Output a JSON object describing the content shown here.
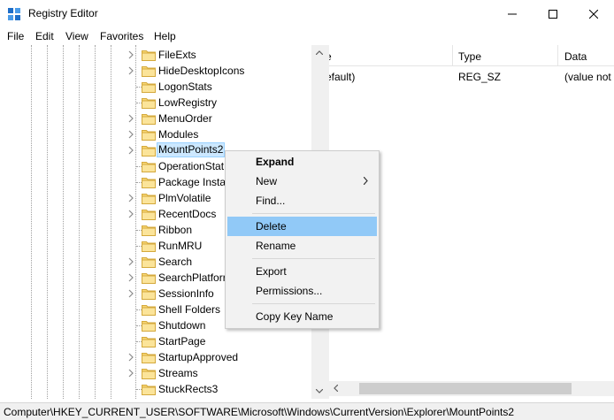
{
  "window": {
    "title": "Registry Editor",
    "app_icon": "regedit-icon",
    "controls": [
      "minimize-icon",
      "maximize-icon",
      "close-icon"
    ]
  },
  "menu": {
    "items": [
      {
        "label": "File"
      },
      {
        "label": "Edit"
      },
      {
        "label": "View"
      },
      {
        "label": "Favorites"
      },
      {
        "label": "Help"
      }
    ]
  },
  "tree": {
    "rows": [
      {
        "label": "FileExts",
        "expandable": true
      },
      {
        "label": "HideDesktopIcons",
        "expandable": true
      },
      {
        "label": "LogonStats",
        "expandable": false
      },
      {
        "label": "LowRegistry",
        "expandable": false
      },
      {
        "label": "MenuOrder",
        "expandable": true
      },
      {
        "label": "Modules",
        "expandable": true
      },
      {
        "label": "MountPoints2",
        "expandable": true,
        "selected": true
      },
      {
        "label": "OperationStat",
        "expandable": false
      },
      {
        "label": "Package Instal",
        "expandable": false
      },
      {
        "label": "PlmVolatile",
        "expandable": true
      },
      {
        "label": "RecentDocs",
        "expandable": true
      },
      {
        "label": "Ribbon",
        "expandable": false
      },
      {
        "label": "RunMRU",
        "expandable": false
      },
      {
        "label": "Search",
        "expandable": true
      },
      {
        "label": "SearchPlatforr",
        "expandable": true
      },
      {
        "label": "SessionInfo",
        "expandable": true
      },
      {
        "label": "Shell Folders",
        "expandable": false
      },
      {
        "label": "Shutdown",
        "expandable": false
      },
      {
        "label": "StartPage",
        "expandable": false
      },
      {
        "label": "StartupApproved",
        "expandable": true
      },
      {
        "label": "Streams",
        "expandable": true
      },
      {
        "label": "StuckRects3",
        "expandable": false
      }
    ]
  },
  "values": {
    "columns": {
      "name": "e",
      "type": "Type",
      "data": "Data"
    },
    "rows": [
      {
        "name": "efault)",
        "type": "REG_SZ",
        "data": "(value not"
      }
    ]
  },
  "context_menu": {
    "items": [
      {
        "label": "Expand",
        "bold": true
      },
      {
        "label": "New",
        "submenu": true
      },
      {
        "label": "Find..."
      },
      {
        "label": "Delete",
        "hover": true
      },
      {
        "label": "Rename"
      },
      {
        "label": "Export"
      },
      {
        "label": "Permissions..."
      },
      {
        "label": "Copy Key Name"
      }
    ]
  },
  "status": {
    "path": "Computer\\HKEY_CURRENT_USER\\SOFTWARE\\Microsoft\\Windows\\CurrentVersion\\Explorer\\MountPoints2"
  },
  "colors": {
    "folder": "#f8d775",
    "selection": "#cce8ff",
    "menu_hover": "#91c9f7"
  }
}
